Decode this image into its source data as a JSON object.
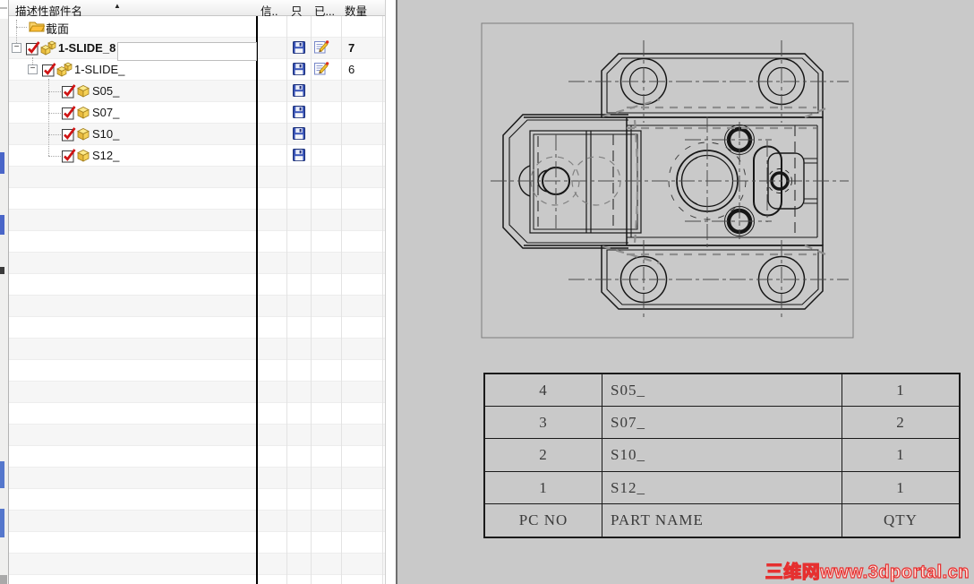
{
  "tree": {
    "header": {
      "name": "描述性部件名",
      "sort_icon": "▲",
      "col_info": "信..",
      "col_read_only": "只",
      "col_modified": "已...",
      "col_quantity": "数量"
    },
    "items": [
      {
        "label": "截面"
      },
      {
        "label": "1-SLIDE_8",
        "expander": "−",
        "qty": "7"
      },
      {
        "label": "1-SLIDE_",
        "expander": "−",
        "qty": "6"
      },
      {
        "label": "S05_"
      },
      {
        "label": "S07_"
      },
      {
        "label": "S10_"
      },
      {
        "label": "S12_"
      }
    ]
  },
  "parts_table": {
    "rows": [
      {
        "pc_no": "4",
        "part_name": "S05_",
        "qty": "1"
      },
      {
        "pc_no": "3",
        "part_name": "S07_",
        "qty": "2"
      },
      {
        "pc_no": "2",
        "part_name": "S10_",
        "qty": "1"
      },
      {
        "pc_no": "1",
        "part_name": "S12_",
        "qty": "1"
      }
    ],
    "footer": {
      "pc_no": "PC NO",
      "part_name": "PART NAME",
      "qty": "QTY"
    }
  },
  "watermark": "三维网www.3dportal.cn",
  "icons": {
    "folder": "folder-icon",
    "checkbox": "checkbox-checked-icon",
    "assembly": "assembly-cubes-icon",
    "part": "cube-icon",
    "saved": "save-disk-icon",
    "modified": "edit-pencil-icon"
  },
  "colors": {
    "canvas": "#c9c9c9",
    "splitter": "#000000",
    "check_red": "#cf1414",
    "cube_yellow": "#f3c53b",
    "save_blue": "#3a55b8",
    "watermark_red": "#e63030"
  }
}
